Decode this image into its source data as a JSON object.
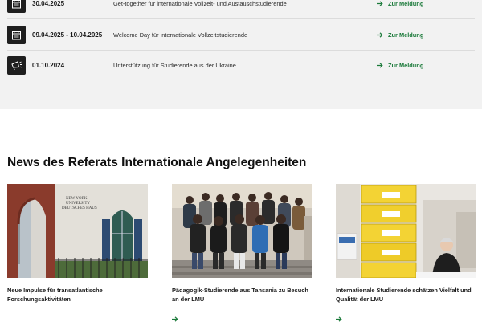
{
  "events": [
    {
      "date": "30.04.2025",
      "title": "Get-together für internationale Vollzeit- und Austauschstudierende",
      "link_label": "Zur Meldung",
      "icon": "calendar-icon"
    },
    {
      "date": "09.04.2025 - 10.04.2025",
      "title": "Welcome Day für internationale Vollzeitstudierende",
      "link_label": "Zur Meldung",
      "icon": "calendar-icon"
    },
    {
      "date": "01.10.2024",
      "title": "Unterstützung für Studierende aus der Ukraine",
      "link_label": "Zur Meldung",
      "icon": "megaphone-icon"
    }
  ],
  "news": {
    "heading": "News des Referats Internationale Angelegenheiten",
    "items": [
      {
        "title": "Neue Impulse für transatlantische Forschungsaktivitäten",
        "image": "new-york-university-deutsches-haus-photo",
        "sign_text": "NEW YORK UNIVERSITY DEUTSCHES HAUS"
      },
      {
        "title": "Pädagogik-Studierende aus Tansania zu Besuch an der LMU",
        "image": "group-of-students-photo"
      },
      {
        "title": "Internationale Studierende schätzen Vielfalt und Qualität der LMU",
        "image": "yellow-crates-and-person-photo"
      }
    ]
  },
  "colors": {
    "accent_green": "#1b7a3a",
    "events_bg": "#f2f2f2",
    "icon_bg": "#1f1f1f"
  }
}
